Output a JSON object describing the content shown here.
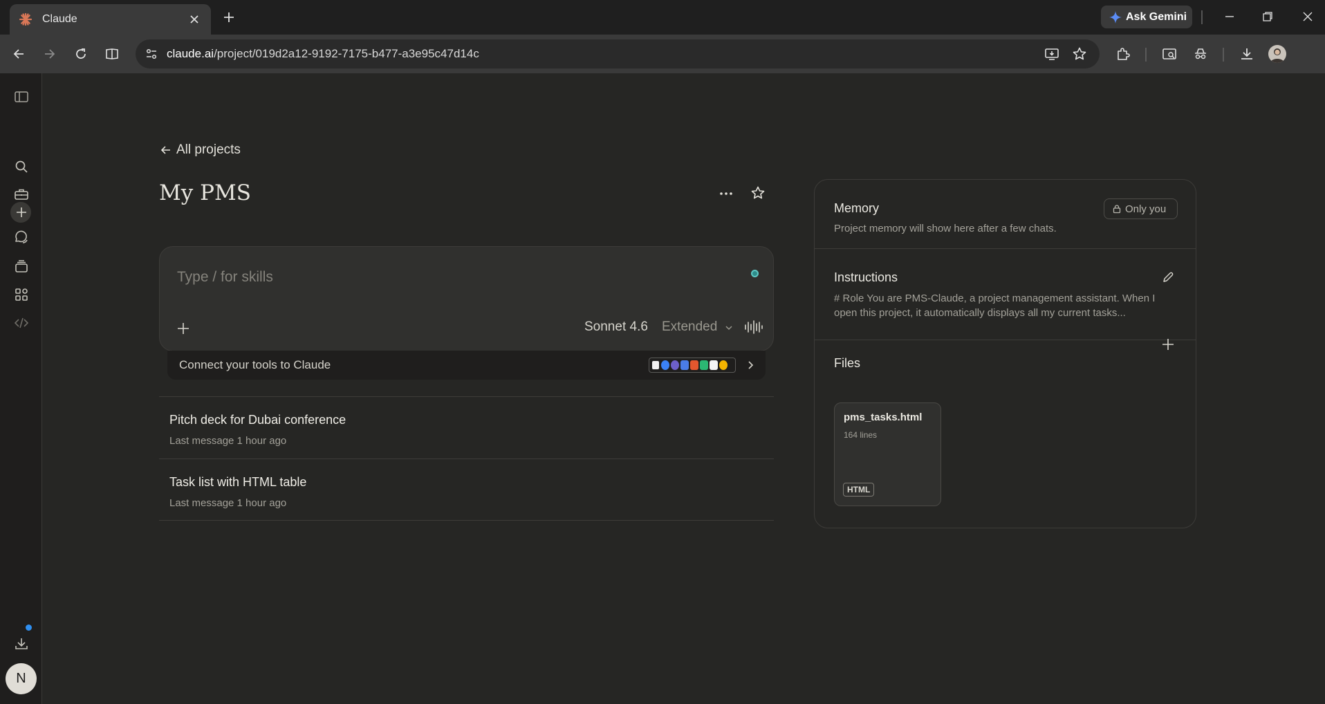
{
  "browser": {
    "tab_title": "Claude",
    "gemini_label": "Ask Gemini",
    "url_host": "claude.ai",
    "url_path": "/project/019d2a12-9192-7175-b477-a3e95c47d14c"
  },
  "project": {
    "back_label": "All projects",
    "title": "My PMS"
  },
  "composer": {
    "placeholder": "Type / for skills",
    "model": "Sonnet 4.6",
    "mode": "Extended"
  },
  "connect": {
    "label": "Connect your tools to Claude"
  },
  "chats": [
    {
      "title": "Pitch deck for Dubai conference",
      "subtitle": "Last message 1 hour ago"
    },
    {
      "title": "Task list with HTML table",
      "subtitle": "Last message 1 hour ago"
    }
  ],
  "memory": {
    "title": "Memory",
    "badge": "Only you",
    "text": "Project memory will show here after a few chats."
  },
  "instructions": {
    "title": "Instructions",
    "text": "# Role You are PMS-Claude, a project management assistant. When I open this project, it automatically displays all my current tasks..."
  },
  "files": {
    "title": "Files",
    "items": [
      {
        "name": "pms_tasks.html",
        "lines": "164 lines",
        "type": "HTML"
      }
    ]
  },
  "user": {
    "initial": "N"
  },
  "colors": {
    "background": "#262624",
    "sidebar": "#1f1e1d",
    "accent_teal": "#5fc7c4",
    "notification_blue": "#2f8ff0"
  }
}
